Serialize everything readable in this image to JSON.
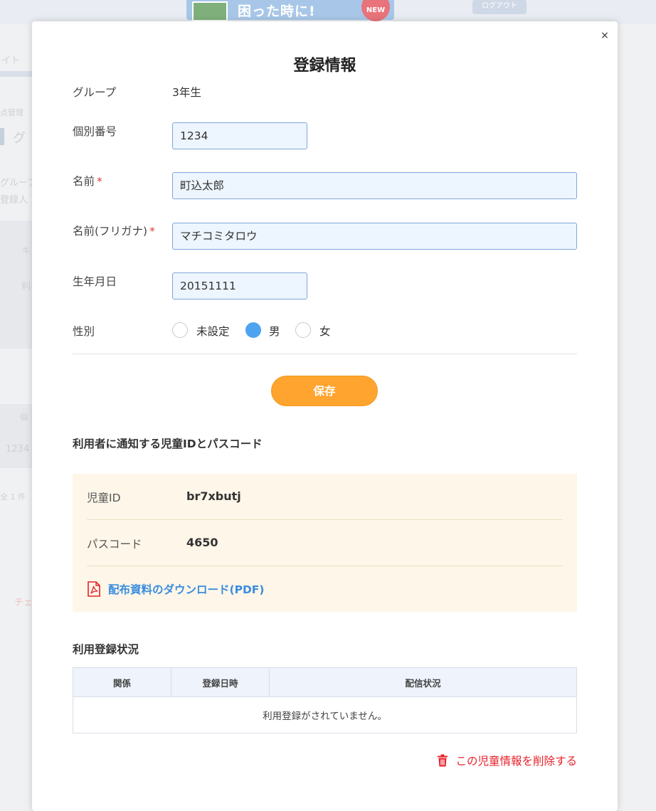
{
  "background": {
    "banner_text": "困った時に!",
    "banner_badge": "NEW",
    "logout_label": "ログアウト",
    "left_fragments": [
      "イト",
      "点管理",
      "グ",
      "グループ",
      "登録人",
      "キ",
      "利",
      "個",
      "1234",
      "全 1 件",
      "チェ"
    ]
  },
  "modal": {
    "title": "登録情報",
    "close_label": "×",
    "fields": {
      "group": {
        "label": "グループ",
        "value": "3年生"
      },
      "number": {
        "label": "個別番号",
        "value": "1234"
      },
      "name": {
        "label": "名前",
        "required_mark": "*",
        "value": "町込太郎"
      },
      "kana": {
        "label": "名前(フリガナ)",
        "required_mark": "*",
        "value": "マチコミタロウ"
      },
      "birthday": {
        "label": "生年月日",
        "value": "20151111"
      },
      "gender": {
        "label": "性別",
        "options": [
          "未設定",
          "男",
          "女"
        ],
        "selected": "男"
      }
    },
    "save_label": "保存",
    "credentials": {
      "title": "利用者に通知する児童IDとパスコード",
      "child_id_label": "児童ID",
      "child_id_value": "br7xbutj",
      "passcode_label": "パスコード",
      "passcode_value": "4650",
      "pdf_link": "配布資料のダウンロード(PDF)"
    },
    "registration": {
      "title": "利用登録状況",
      "columns": [
        "関係",
        "登録日時",
        "配信状況"
      ],
      "empty_message": "利用登録がされていません。"
    },
    "delete_label": "この児童情報を削除する"
  },
  "colors": {
    "accent_orange": "#ffa42e",
    "link_blue": "#3a8de0",
    "danger_red": "#e8202a",
    "radio_selected": "#4da3f0"
  }
}
